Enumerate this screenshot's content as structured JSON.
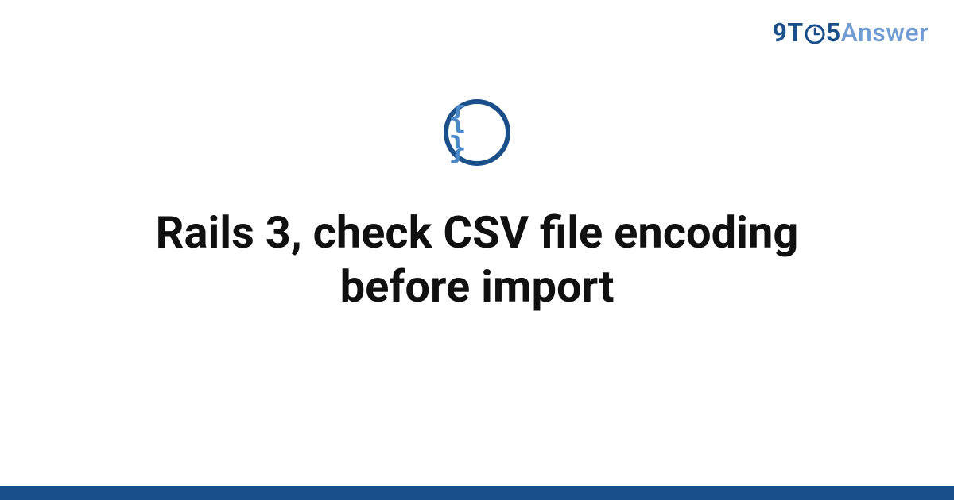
{
  "brand": {
    "part_nine": "9",
    "part_t": "T",
    "part_five": "5",
    "part_answer": "Answer"
  },
  "category_icon_glyph": "{ }",
  "headline": "Rails 3, check CSV file encoding before import"
}
